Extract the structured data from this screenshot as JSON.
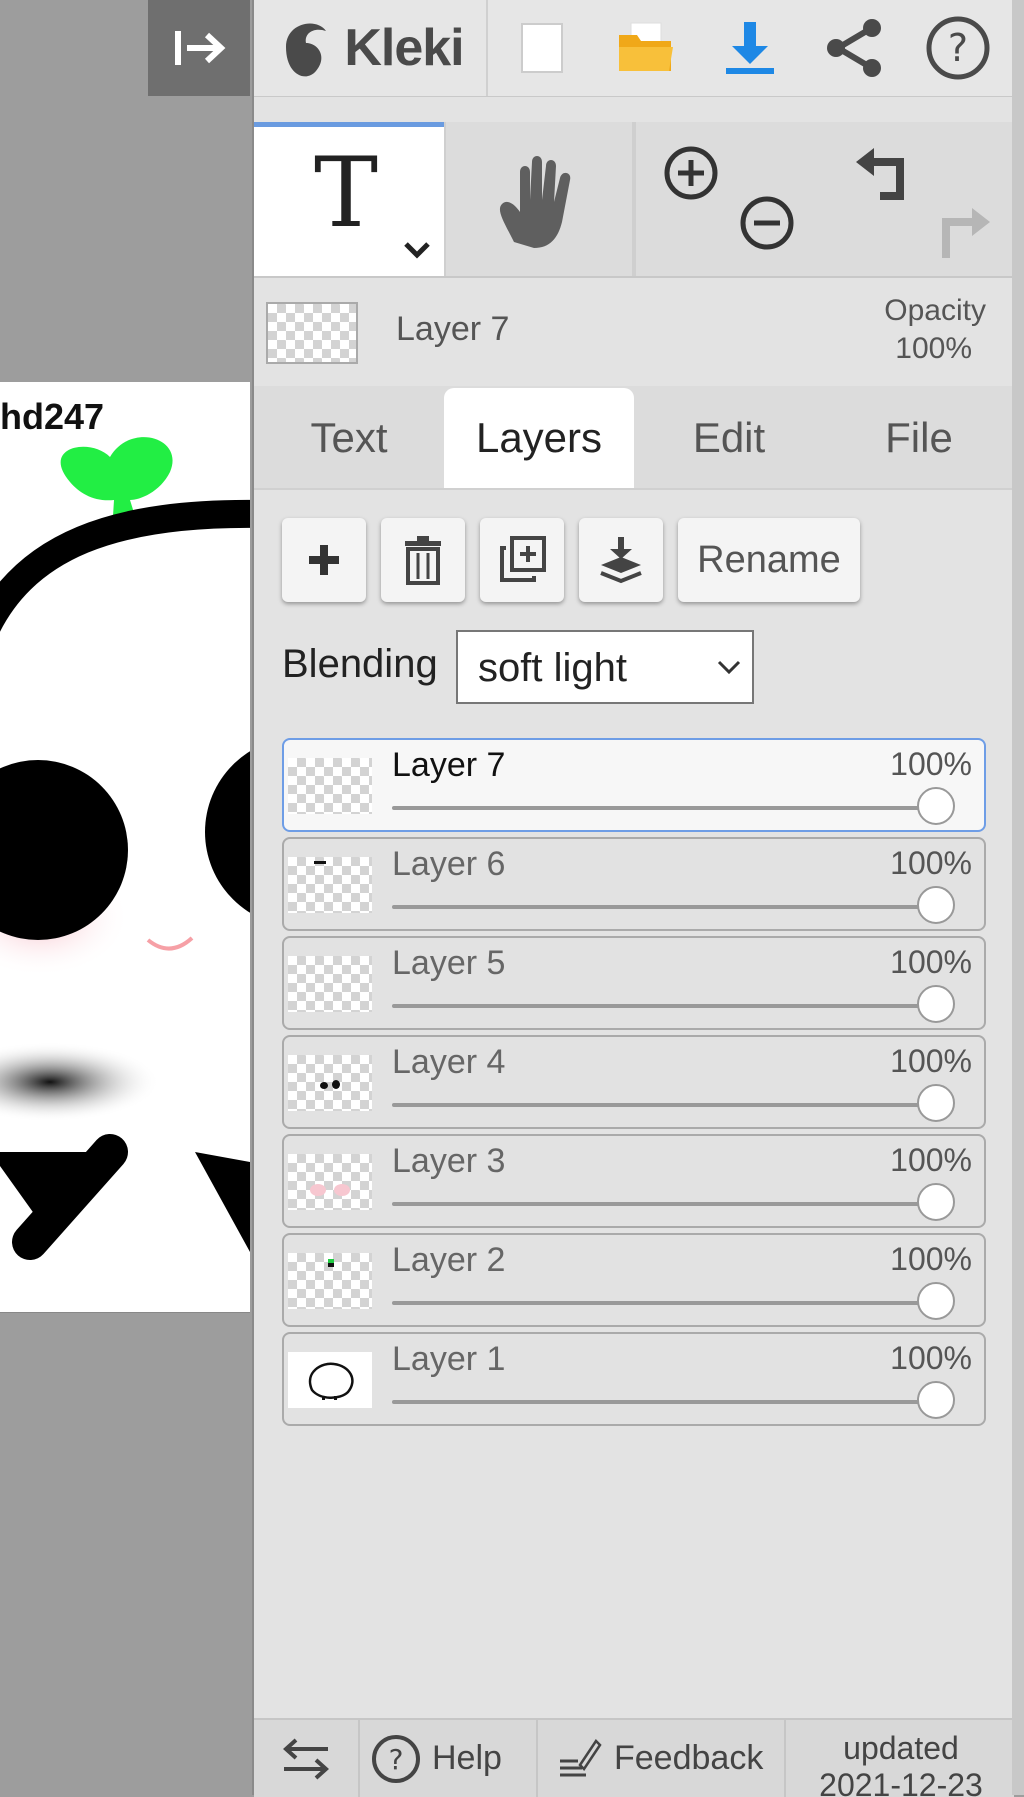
{
  "app": {
    "title": "Kleki"
  },
  "canvas": {
    "visible_text": "hd247"
  },
  "toolbar": {
    "icons": [
      "collapse-icon",
      "kleki-logo-icon",
      "new-image-icon",
      "open-folder-icon",
      "download-icon",
      "share-icon",
      "help-icon"
    ],
    "accent_color": "#1e88e5"
  },
  "tools": {
    "text_tool": "T",
    "icons": [
      "text-tool-icon",
      "hand-tool-icon",
      "zoom-in-icon",
      "zoom-out-icon",
      "undo-icon",
      "redo-icon"
    ]
  },
  "current_layer": {
    "name": "Layer 7",
    "opacity_label": "Opacity",
    "opacity_value": "100%"
  },
  "tabs": [
    {
      "label": "Text"
    },
    {
      "label": "Layers",
      "active": true
    },
    {
      "label": "Edit"
    },
    {
      "label": "File"
    }
  ],
  "layer_actions": {
    "rename_label": "Rename",
    "icons": [
      "add-layer-icon",
      "delete-layer-icon",
      "duplicate-layer-icon",
      "merge-down-icon"
    ]
  },
  "blending": {
    "label": "Blending",
    "value": "soft light"
  },
  "layers": [
    {
      "name": "Layer 7",
      "opacity": "100%",
      "opacity_fraction": 1.0,
      "selected": true
    },
    {
      "name": "Layer 6",
      "opacity": "100%",
      "opacity_fraction": 1.0
    },
    {
      "name": "Layer 5",
      "opacity": "100%",
      "opacity_fraction": 1.0
    },
    {
      "name": "Layer 4",
      "opacity": "100%",
      "opacity_fraction": 1.0
    },
    {
      "name": "Layer 3",
      "opacity": "100%",
      "opacity_fraction": 1.0
    },
    {
      "name": "Layer 2",
      "opacity": "100%",
      "opacity_fraction": 1.0
    },
    {
      "name": "Layer 1",
      "opacity": "100%",
      "opacity_fraction": 1.0
    }
  ],
  "footer": {
    "help_label": "Help",
    "feedback_label": "Feedback",
    "updated_label": "updated",
    "updated_date": "2021-12-23"
  }
}
